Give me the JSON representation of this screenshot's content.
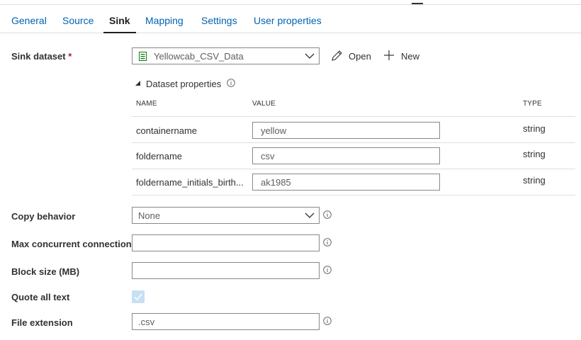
{
  "tabs": [
    {
      "label": "General",
      "active": false
    },
    {
      "label": "Source",
      "active": false
    },
    {
      "label": "Sink",
      "active": true
    },
    {
      "label": "Mapping",
      "active": false
    },
    {
      "label": "Settings",
      "active": false
    },
    {
      "label": "User properties",
      "active": false
    }
  ],
  "sink_dataset": {
    "label": "Sink dataset",
    "required_mark": "*",
    "value": "Yellowcab_CSV_Data",
    "open_label": "Open",
    "new_label": "New"
  },
  "dataset_properties": {
    "title": "Dataset properties",
    "columns": {
      "name": "NAME",
      "value": "VALUE",
      "type": "TYPE"
    },
    "rows": [
      {
        "name": "containername",
        "value": "yellow",
        "type": "string"
      },
      {
        "name": "foldername",
        "value": "csv",
        "type": "string"
      },
      {
        "name": "foldername_initials_birth...",
        "value": "ak1985",
        "type": "string"
      }
    ]
  },
  "copy_behavior": {
    "label": "Copy behavior",
    "value": "None"
  },
  "max_concurrent": {
    "label": "Max concurrent connections",
    "value": ""
  },
  "block_size": {
    "label": "Block size (MB)",
    "value": ""
  },
  "quote_all_text": {
    "label": "Quote all text",
    "checked": true
  },
  "file_extension": {
    "label": "File extension",
    "value": ".csv"
  },
  "colors": {
    "accent": "#0063b1",
    "required": "#a4262c",
    "checkbox": "#c7e0f4"
  }
}
